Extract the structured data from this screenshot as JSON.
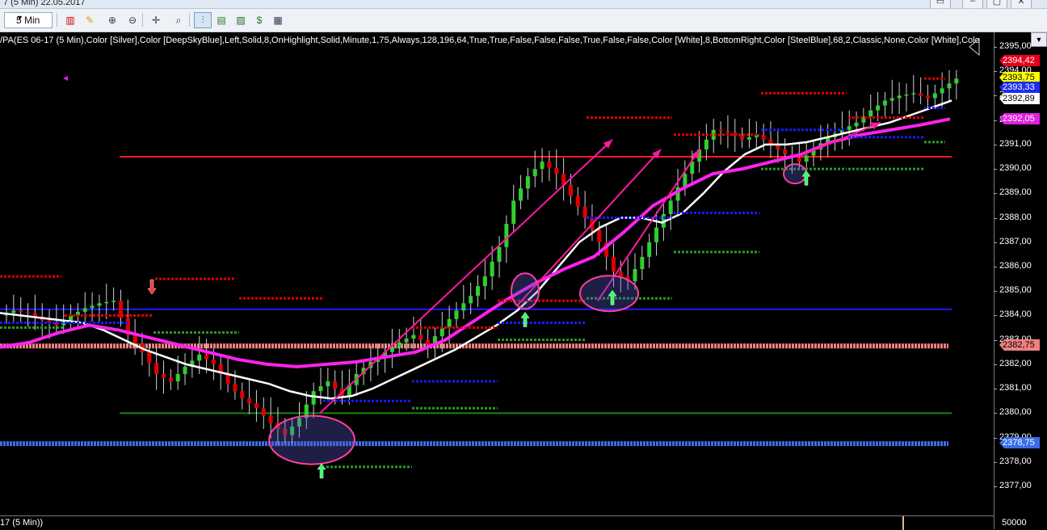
{
  "window": {
    "title": "7 (5 Min)  22.05.2017",
    "buttons": [
      "▭",
      "–",
      "▢",
      "✕"
    ]
  },
  "toolbar": {
    "timeframe": "5 Min",
    "icons": [
      "bar-chart-icon",
      "pencil-icon",
      "zoom-in-icon",
      "zoom-out-icon",
      "crosshair-icon",
      "search-icon",
      "indicators-icon",
      "data-box-icon",
      "dollar-icon",
      "properties-icon"
    ]
  },
  "indicator_label": "/PA(ES  06-17  (5  Min),Color  [Silver],Color  [DeepSkyBlue],Left,Solid,8,OnHighlight,Solid,Minute,1,75,Always,128,196,64,True,True,False,False,False,True,False,False,Color  [White],8,BottomRight,Color  [SteelBlue],68,2,Classic,None,Color  [White],Colo",
  "panel2_label": "17 (5 Min))",
  "volume_tick": "50000",
  "price_labels": [
    {
      "text": "2394,42",
      "bg": "#e8001c",
      "fg": "#ffffff"
    },
    {
      "text": "2393,75",
      "bg": "#ffff00",
      "fg": "#000000"
    },
    {
      "text": "2393,33",
      "bg": "#1c2cf0",
      "fg": "#ffffff"
    },
    {
      "text": "2392,89",
      "bg": "#ffffff",
      "fg": "#000000"
    },
    {
      "text": "2392,05",
      "bg": "#e020e0",
      "fg": "#ffffff"
    },
    {
      "text": "2382,75",
      "bg": "#f08080",
      "fg": "#000000"
    },
    {
      "text": "2378,75",
      "bg": "#3a6ee8",
      "fg": "#ffffff"
    }
  ],
  "chart_data": {
    "type": "candlestick",
    "instrument": "ES 06-17",
    "timeframe": "5 Min",
    "ylim": [
      2376.5,
      2395.4
    ],
    "y_ticks": [
      "2395,00",
      "2394,00",
      "2393,00",
      "2392,00",
      "2391,00",
      "2390,00",
      "2389,00",
      "2388,00",
      "2387,00",
      "2386,00",
      "2385,00",
      "2384,00",
      "2383,00",
      "2382,00",
      "2381,00",
      "2380,00",
      "2379,00",
      "2378,00",
      "2377,00"
    ],
    "horizontal_levels": [
      {
        "price": 2390.5,
        "color": "#ff1a1a"
      },
      {
        "price": 2384.25,
        "color": "#1a1aff"
      },
      {
        "price": 2382.75,
        "color": "#f08080"
      },
      {
        "price": 2380.0,
        "color": "#118811"
      },
      {
        "price": 2378.75,
        "color": "#3a6ee8"
      }
    ],
    "close_path": [
      2384.2,
      2384.1,
      2383.8,
      2383.6,
      2384.0,
      2384.3,
      2384.5,
      2384.6,
      2383.2,
      2382.5,
      2381.6,
      2381.3,
      2381.9,
      2382.4,
      2382.0,
      2381.2,
      2380.6,
      2380.2,
      2379.6,
      2379.1,
      2379.8,
      2380.9,
      2381.3,
      2380.7,
      2381.6,
      2382.1,
      2382.5,
      2382.9,
      2383.2,
      2382.8,
      2383.5,
      2384.2,
      2384.8,
      2385.6,
      2386.8,
      2388.7,
      2389.7,
      2390.3,
      2389.8,
      2388.9,
      2388.0,
      2387.0,
      2385.8,
      2385.4,
      2386.4,
      2387.6,
      2388.7,
      2389.8,
      2390.8,
      2391.6,
      2391.5,
      2391.2,
      2391.4,
      2391.0,
      2390.6,
      2390.3,
      2390.8,
      2391.3,
      2391.6,
      2391.9,
      2392.4,
      2392.8,
      2393.0,
      2393.1,
      2392.9,
      2393.3,
      2393.7
    ],
    "white_ma": [
      2384.1,
      2384.0,
      2383.9,
      2383.8,
      2383.7,
      2383.4,
      2383.0,
      2382.6,
      2382.3,
      2382.0,
      2381.8,
      2381.6,
      2381.4,
      2381.2,
      2380.9,
      2380.7,
      2380.6,
      2380.7,
      2381.0,
      2381.4,
      2381.8,
      2382.2,
      2382.6,
      2383.1,
      2383.6,
      2384.2,
      2385.0,
      2386.0,
      2387.0,
      2387.6,
      2388.0,
      2388.0,
      2387.8,
      2388.2,
      2389.0,
      2389.9,
      2390.6,
      2391.0,
      2391.0,
      2391.1,
      2391.3,
      2391.5,
      2391.7,
      2391.9,
      2392.2,
      2392.5,
      2392.8
    ],
    "magenta_ma": [
      2382.7,
      2382.9,
      2383.3,
      2383.6,
      2383.4,
      2383.1,
      2382.8,
      2382.5,
      2382.2,
      2382.0,
      2381.9,
      2382.0,
      2382.1,
      2382.3,
      2382.5,
      2383.0,
      2383.8,
      2384.6,
      2385.3,
      2385.9,
      2386.4,
      2387.4,
      2388.5,
      2389.2,
      2389.8,
      2390.0,
      2390.3,
      2390.6,
      2391.1,
      2391.4,
      2391.6,
      2391.8,
      2392.05
    ],
    "volume_axis_label": "50000"
  }
}
